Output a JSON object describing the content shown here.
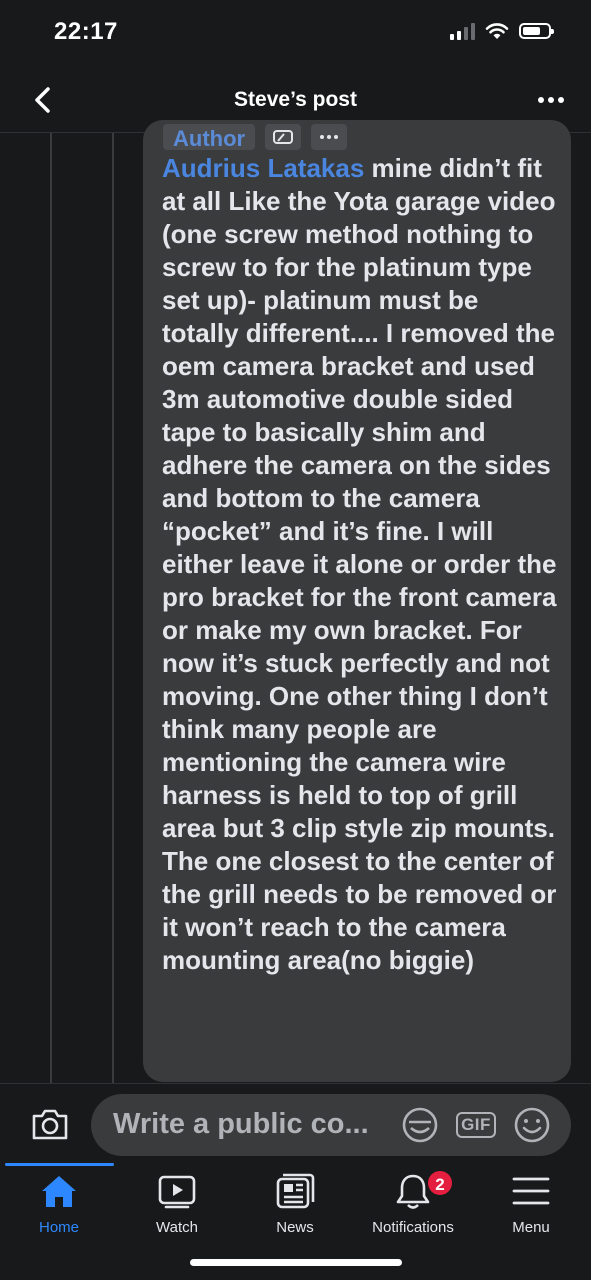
{
  "status_bar": {
    "time": "22:17"
  },
  "header": {
    "title": "Steve’s post"
  },
  "comment": {
    "badge": "Author",
    "author": "Audrius Latakas",
    "text": " mine didn’t fit at all Like the Yota garage video (one screw method nothing to screw to for the platinum type set up)- platinum must be totally different....  I removed the oem camera bracket and used 3m automotive double sided tape to basically shim and adhere the camera on the sides and bottom to the camera “pocket” and it’s fine. I will either leave it alone or order the pro bracket for the front camera or make my own bracket. For now it’s stuck perfectly and not moving. One other thing I don’t think many people are mentioning the camera wire harness is held to top of grill area but 3 clip style zip mounts. The one closest to the center of the grill needs to be removed or it won’t reach to the camera mounting area(no biggie)"
  },
  "composer": {
    "placeholder": "Write a public co...",
    "gif_label": "GIF"
  },
  "tabs": [
    {
      "label": "Home",
      "icon": "home-icon",
      "active": true
    },
    {
      "label": "Watch",
      "icon": "watch-icon"
    },
    {
      "label": "News",
      "icon": "news-icon"
    },
    {
      "label": "Notifications",
      "icon": "bell-icon",
      "badge": "2"
    },
    {
      "label": "Menu",
      "icon": "menu-icon"
    }
  ],
  "colors": {
    "accent": "#2d88ff",
    "author_link": "#4a86e0",
    "badge": "#e41e3f",
    "background": "#18191a",
    "bubble": "#3a3b3c"
  }
}
